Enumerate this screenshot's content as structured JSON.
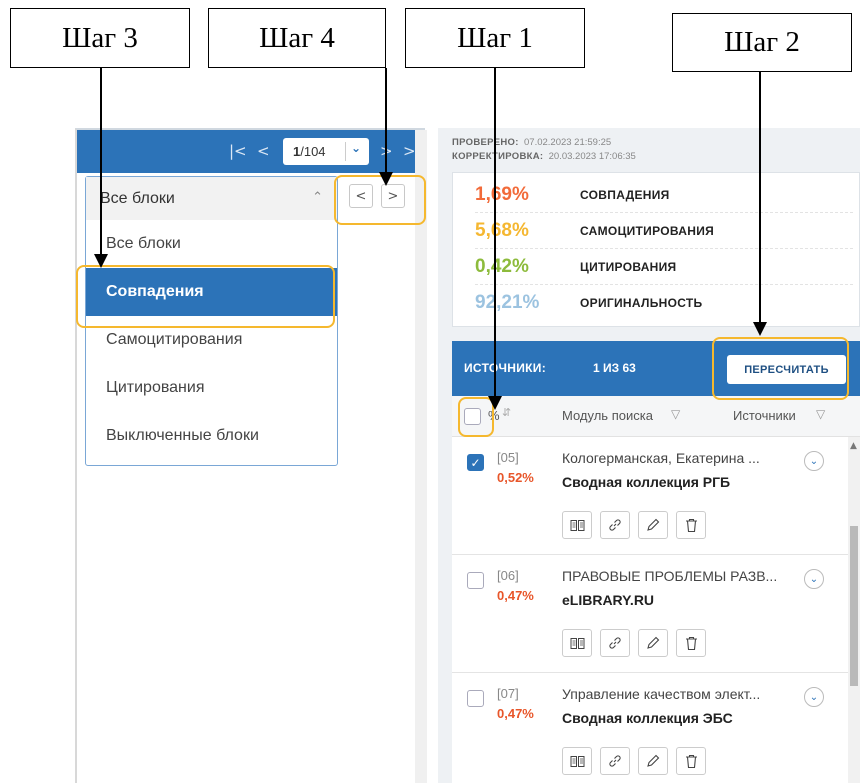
{
  "steps": [
    {
      "label": "Шаг 3"
    },
    {
      "label": "Шаг 4"
    },
    {
      "label": "Шаг 1"
    },
    {
      "label": "Шаг 2"
    }
  ],
  "toolbar": {
    "first_icon": "first-page-icon",
    "prev_icon": "prev-page-icon",
    "page_current": "1",
    "page_total": "/104",
    "next_icon": "next-page-icon",
    "last_icon": "last-page-icon"
  },
  "block_filter": {
    "selected": "Все блоки",
    "options": [
      "Все блоки",
      "Совпадения",
      "Самоцитирования",
      "Цитирования",
      "Выключенные блоки"
    ],
    "active_option": "Совпадения"
  },
  "block_nav": {
    "prev_icon": "chevron-left-icon",
    "next_icon": "chevron-right-icon"
  },
  "check_info": {
    "checked_label": "ПРОВЕРЕНО:",
    "checked_value": "07.02.2023 21:59:25",
    "corrected_label": "КОРРЕКТИРОВКА:",
    "corrected_value": "20.03.2023 17:06:35"
  },
  "stats": [
    {
      "value": "1,69%",
      "label": "СОВПАДЕНИЯ",
      "color": "#f26b3a"
    },
    {
      "value": "5,68%",
      "label": "САМОЦИТИРОВАНИЯ",
      "color": "#f5b731"
    },
    {
      "value": "0,42%",
      "label": "ЦИТИРОВАНИЯ",
      "color": "#8dbb3c"
    },
    {
      "value": "92,21%",
      "label": "ОРИГИНАЛЬНОСТЬ",
      "color": "#9cc3e0"
    }
  ],
  "sources": {
    "title": "ИСТОЧНИКИ:",
    "count": "1 ИЗ 63",
    "recalc_label": "ПЕРЕСЧИТАТЬ",
    "col_percent": "%",
    "col_module": "Модуль поиска",
    "col_sources": "Источники",
    "items": [
      {
        "index": "[05]",
        "percent": "0,52%",
        "name": "Кологерманская, Екатерина ...",
        "collection": "Сводная коллекция РГБ",
        "checked": true
      },
      {
        "index": "[06]",
        "percent": "0,47%",
        "name": "ПРАВОВЫЕ ПРОБЛЕМЫ РАЗВ...",
        "collection": "eLIBRARY.RU",
        "checked": false
      },
      {
        "index": "[07]",
        "percent": "0,47%",
        "name": "Управление качеством элект...",
        "collection": "Сводная коллекция ЭБС",
        "checked": false
      }
    ],
    "action_icons": [
      "book-icon",
      "link-icon",
      "pencil-icon",
      "trash-icon"
    ]
  },
  "colors": {
    "accent": "#2c73b8",
    "highlight": "#f5b82e",
    "match": "#e8562a"
  }
}
